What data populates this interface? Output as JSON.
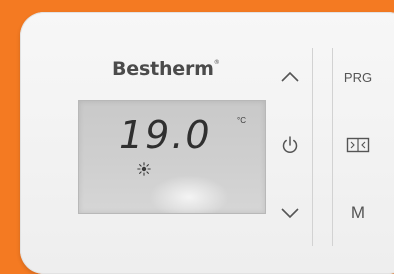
{
  "device": {
    "brand": "Bestherm",
    "registered_mark": "®"
  },
  "display": {
    "temperature": "19.0",
    "unit": "°C",
    "mode_icon": "sun-icon"
  },
  "buttons": {
    "up": {
      "icon": "chevron-up-icon"
    },
    "power": {
      "icon": "power-icon"
    },
    "down": {
      "icon": "chevron-down-icon"
    },
    "program": {
      "label": "PRG"
    },
    "window": {
      "icon": "window-icon"
    },
    "mode": {
      "label": "M"
    }
  },
  "colors": {
    "background": "#f47a22",
    "panel": "#f2f2f2",
    "lcd": "#cbcbcb",
    "text": "#555555"
  }
}
